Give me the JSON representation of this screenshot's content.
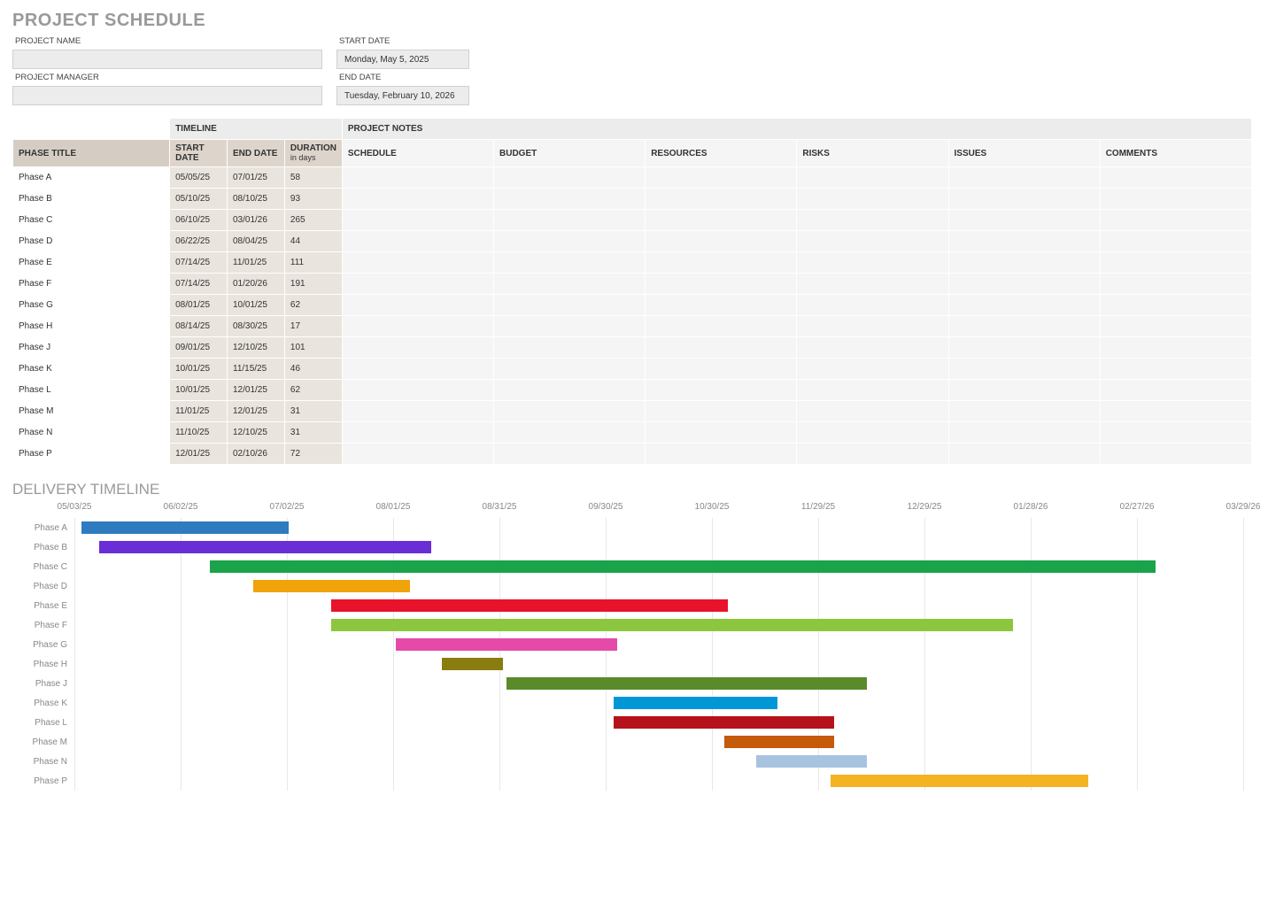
{
  "page": {
    "title": "PROJECT SCHEDULE",
    "delivery_title": "DELIVERY TIMELINE"
  },
  "meta": {
    "project_name_label": "PROJECT NAME",
    "project_name": "",
    "project_manager_label": "PROJECT MANAGER",
    "project_manager": "",
    "start_date_label": "START DATE",
    "start_date": "Monday, May 5, 2025",
    "end_date_label": "END DATE",
    "end_date": "Tuesday, February 10, 2026"
  },
  "headers": {
    "phase_title": "PHASE TITLE",
    "timeline": "TIMELINE",
    "project_notes": "PROJECT NOTES",
    "start_date": "START DATE",
    "end_date": "END DATE",
    "duration": "DURATION",
    "duration_sub": "in days",
    "schedule": "SCHEDULE",
    "budget": "BUDGET",
    "resources": "RESOURCES",
    "risks": "RISKS",
    "issues": "ISSUES",
    "comments": "COMMENTS"
  },
  "rows": [
    {
      "title": "Phase A",
      "start": "05/05/25",
      "end": "07/01/25",
      "dur": "58",
      "schedule": "",
      "budget": "",
      "resources": "",
      "risks": "",
      "issues": "",
      "comments": ""
    },
    {
      "title": "Phase B",
      "start": "05/10/25",
      "end": "08/10/25",
      "dur": "93",
      "schedule": "",
      "budget": "",
      "resources": "",
      "risks": "",
      "issues": "",
      "comments": ""
    },
    {
      "title": "Phase C",
      "start": "06/10/25",
      "end": "03/01/26",
      "dur": "265",
      "schedule": "",
      "budget": "",
      "resources": "",
      "risks": "",
      "issues": "",
      "comments": ""
    },
    {
      "title": "Phase D",
      "start": "06/22/25",
      "end": "08/04/25",
      "dur": "44",
      "schedule": "",
      "budget": "",
      "resources": "",
      "risks": "",
      "issues": "",
      "comments": ""
    },
    {
      "title": "Phase E",
      "start": "07/14/25",
      "end": "11/01/25",
      "dur": "111",
      "schedule": "",
      "budget": "",
      "resources": "",
      "risks": "",
      "issues": "",
      "comments": ""
    },
    {
      "title": "Phase F",
      "start": "07/14/25",
      "end": "01/20/26",
      "dur": "191",
      "schedule": "",
      "budget": "",
      "resources": "",
      "risks": "",
      "issues": "",
      "comments": ""
    },
    {
      "title": "Phase G",
      "start": "08/01/25",
      "end": "10/01/25",
      "dur": "62",
      "schedule": "",
      "budget": "",
      "resources": "",
      "risks": "",
      "issues": "",
      "comments": ""
    },
    {
      "title": "Phase H",
      "start": "08/14/25",
      "end": "08/30/25",
      "dur": "17",
      "schedule": "",
      "budget": "",
      "resources": "",
      "risks": "",
      "issues": "",
      "comments": ""
    },
    {
      "title": "Phase J",
      "start": "09/01/25",
      "end": "12/10/25",
      "dur": "101",
      "schedule": "",
      "budget": "",
      "resources": "",
      "risks": "",
      "issues": "",
      "comments": ""
    },
    {
      "title": "Phase K",
      "start": "10/01/25",
      "end": "11/15/25",
      "dur": "46",
      "schedule": "",
      "budget": "",
      "resources": "",
      "risks": "",
      "issues": "",
      "comments": ""
    },
    {
      "title": "Phase L",
      "start": "10/01/25",
      "end": "12/01/25",
      "dur": "62",
      "schedule": "",
      "budget": "",
      "resources": "",
      "risks": "",
      "issues": "",
      "comments": ""
    },
    {
      "title": "Phase M",
      "start": "11/01/25",
      "end": "12/01/25",
      "dur": "31",
      "schedule": "",
      "budget": "",
      "resources": "",
      "risks": "",
      "issues": "",
      "comments": ""
    },
    {
      "title": "Phase N",
      "start": "11/10/25",
      "end": "12/10/25",
      "dur": "31",
      "schedule": "",
      "budget": "",
      "resources": "",
      "risks": "",
      "issues": "",
      "comments": ""
    },
    {
      "title": "Phase P",
      "start": "12/01/25",
      "end": "02/10/26",
      "dur": "72",
      "schedule": "",
      "budget": "",
      "resources": "",
      "risks": "",
      "issues": "",
      "comments": ""
    }
  ],
  "chart_data": {
    "type": "bar",
    "title": "DELIVERY TIMELINE",
    "xlabel": "",
    "ylabel": "",
    "x_ticks": [
      "05/03/25",
      "06/02/25",
      "07/02/25",
      "08/01/25",
      "08/31/25",
      "09/30/25",
      "10/30/25",
      "11/29/25",
      "12/29/25",
      "01/28/26",
      "02/27/26",
      "03/29/26"
    ],
    "x_range_days": [
      0,
      330
    ],
    "series": [
      {
        "name": "Phase A",
        "start_day": 2,
        "duration": 58,
        "color": "#2e7bc0"
      },
      {
        "name": "Phase B",
        "start_day": 7,
        "duration": 93,
        "color": "#6a2ed6"
      },
      {
        "name": "Phase C",
        "start_day": 38,
        "duration": 265,
        "color": "#1aa34a"
      },
      {
        "name": "Phase D",
        "start_day": 50,
        "duration": 44,
        "color": "#f0a30a"
      },
      {
        "name": "Phase E",
        "start_day": 72,
        "duration": 111,
        "color": "#e8132b"
      },
      {
        "name": "Phase F",
        "start_day": 72,
        "duration": 191,
        "color": "#8cc63f"
      },
      {
        "name": "Phase G",
        "start_day": 90,
        "duration": 62,
        "color": "#e64aa9"
      },
      {
        "name": "Phase H",
        "start_day": 103,
        "duration": 17,
        "color": "#8a7d0f"
      },
      {
        "name": "Phase J",
        "start_day": 121,
        "duration": 101,
        "color": "#5a8a2a"
      },
      {
        "name": "Phase K",
        "start_day": 151,
        "duration": 46,
        "color": "#0097d6"
      },
      {
        "name": "Phase L",
        "start_day": 151,
        "duration": 62,
        "color": "#b5121b"
      },
      {
        "name": "Phase M",
        "start_day": 182,
        "duration": 31,
        "color": "#c45a0a"
      },
      {
        "name": "Phase N",
        "start_day": 191,
        "duration": 31,
        "color": "#a7c3e0"
      },
      {
        "name": "Phase P",
        "start_day": 212,
        "duration": 72,
        "color": "#f5b223"
      }
    ]
  }
}
